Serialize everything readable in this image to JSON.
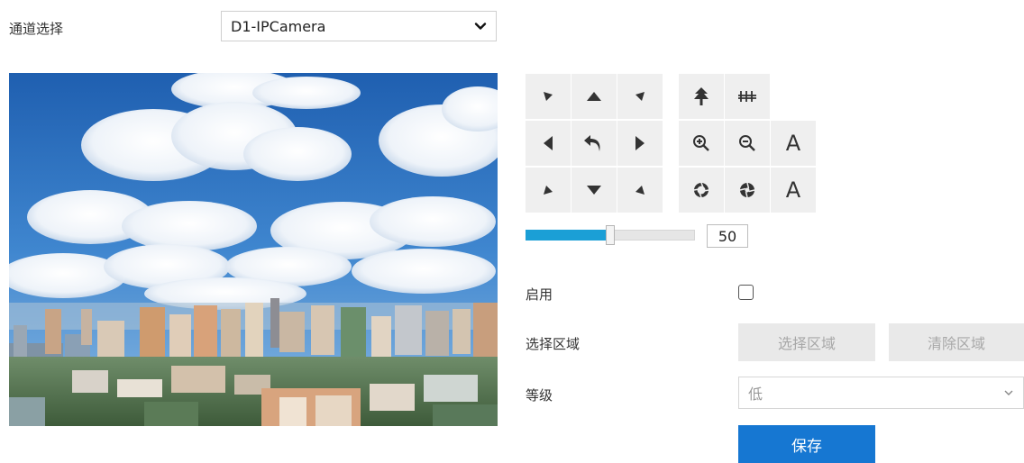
{
  "channel": {
    "label": "通道选择",
    "selected": "D1-IPCamera"
  },
  "preview": {
    "description": "camera-live-preview"
  },
  "ptz": {
    "slider_value": "50",
    "slider_fraction": 0.5,
    "focus_label": "A",
    "iris_label": "A"
  },
  "form": {
    "enable_label": "启用",
    "enable_checked": false,
    "region_label": "选择区域",
    "select_region_button": "选择区域",
    "clear_region_button": "清除区域",
    "level_label": "等级",
    "level_value": "低",
    "save_button": "保存"
  },
  "colors": {
    "accent": "#1677d2",
    "slider_fill": "#1b9fd6",
    "button_bg": "#efefef"
  }
}
